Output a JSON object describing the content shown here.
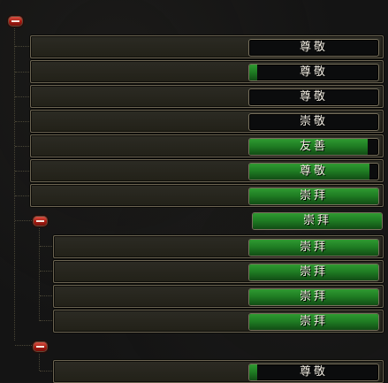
{
  "rows": [
    {
      "label": "尊敬",
      "progress": 0
    },
    {
      "label": "尊敬",
      "progress": 0.06
    },
    {
      "label": "尊敬",
      "progress": 0
    },
    {
      "label": "崇敬",
      "progress": 0
    },
    {
      "label": "友善",
      "progress": 0.92
    },
    {
      "label": "尊敬",
      "progress": 0.93
    },
    {
      "label": "崇拜",
      "progress": 1
    }
  ],
  "group1": {
    "label": "崇拜",
    "progress": 1
  },
  "group1_rows": [
    {
      "label": "崇拜",
      "progress": 1
    },
    {
      "label": "崇拜",
      "progress": 1
    },
    {
      "label": "崇拜",
      "progress": 1
    },
    {
      "label": "崇拜",
      "progress": 1
    }
  ],
  "group2_rows": [
    {
      "label": "尊敬",
      "progress": 0.06
    }
  ]
}
